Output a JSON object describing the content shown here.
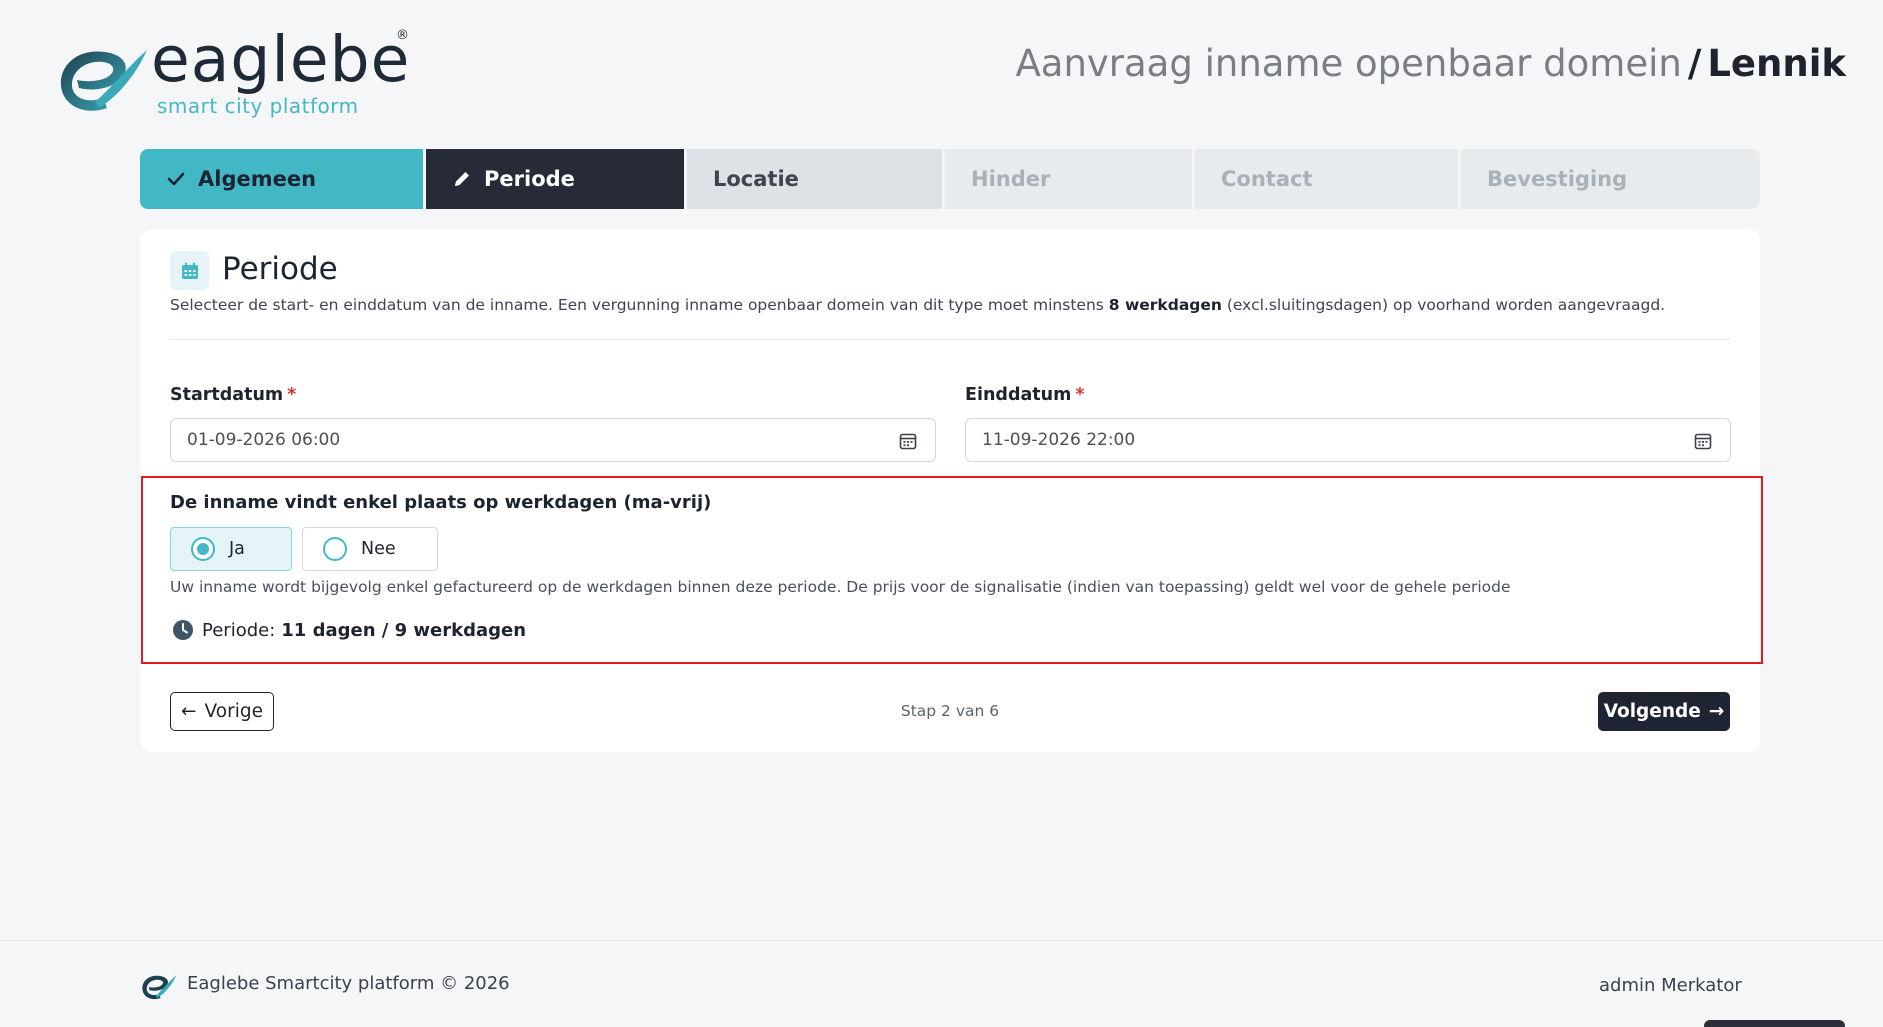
{
  "header": {
    "logo_word": "eaglebe",
    "logo_registered": "®",
    "logo_tagline": "smart city platform",
    "title_main": "Aanvraag inname openbaar domein",
    "title_separator": "/",
    "title_municipality": "Lennik"
  },
  "stepper": {
    "steps": [
      {
        "label": "Algemeen",
        "state": "completed",
        "icon": "check-icon"
      },
      {
        "label": "Periode",
        "state": "active",
        "icon": "pencil-icon"
      },
      {
        "label": "Locatie",
        "state": "upcoming"
      },
      {
        "label": "Hinder",
        "state": "disabled"
      },
      {
        "label": "Contact",
        "state": "disabled"
      },
      {
        "label": "Bevestiging",
        "state": "disabled"
      }
    ]
  },
  "section": {
    "icon": "calendar-icon",
    "title": "Periode",
    "description_pre": "Selecteer de start- en einddatum van de inname. Een vergunning inname openbaar domein van dit type moet minstens ",
    "description_bold": "8 werkdagen",
    "description_post": " (excl.sluitingsdagen) op voorhand worden aangevraagd."
  },
  "form": {
    "start": {
      "label": "Startdatum",
      "required_mark": "*",
      "value": "01-09-2026 06:00"
    },
    "end": {
      "label": "Einddatum",
      "required_mark": "*",
      "value": "11-09-2026 22:00"
    },
    "weekdays_question": "De inname vindt enkel plaats op werkdagen (ma-vrij)",
    "options": [
      {
        "label": "Ja",
        "selected": true
      },
      {
        "label": "Nee",
        "selected": false
      }
    ],
    "weekdays_note": "Uw inname wordt bijgevolg enkel gefactureerd op de werkdagen binnen deze periode. De prijs voor de signalisatie (indien van toepassing) geldt wel voor de gehele periode",
    "period_prefix": "Periode:",
    "period_value": "11 dagen / 9 werkdagen"
  },
  "navigation": {
    "prev_label": "Vorige",
    "step_indicator": "Stap 2 van 6",
    "next_label": "Volgende"
  },
  "footer": {
    "copyright": "Eaglebe Smartcity platform © 2026",
    "user": "admin Merkator"
  },
  "colors": {
    "accent": "#42b8c7",
    "dark": "#272b37",
    "highlight_border": "#e01b24",
    "required": "#d9342b"
  }
}
